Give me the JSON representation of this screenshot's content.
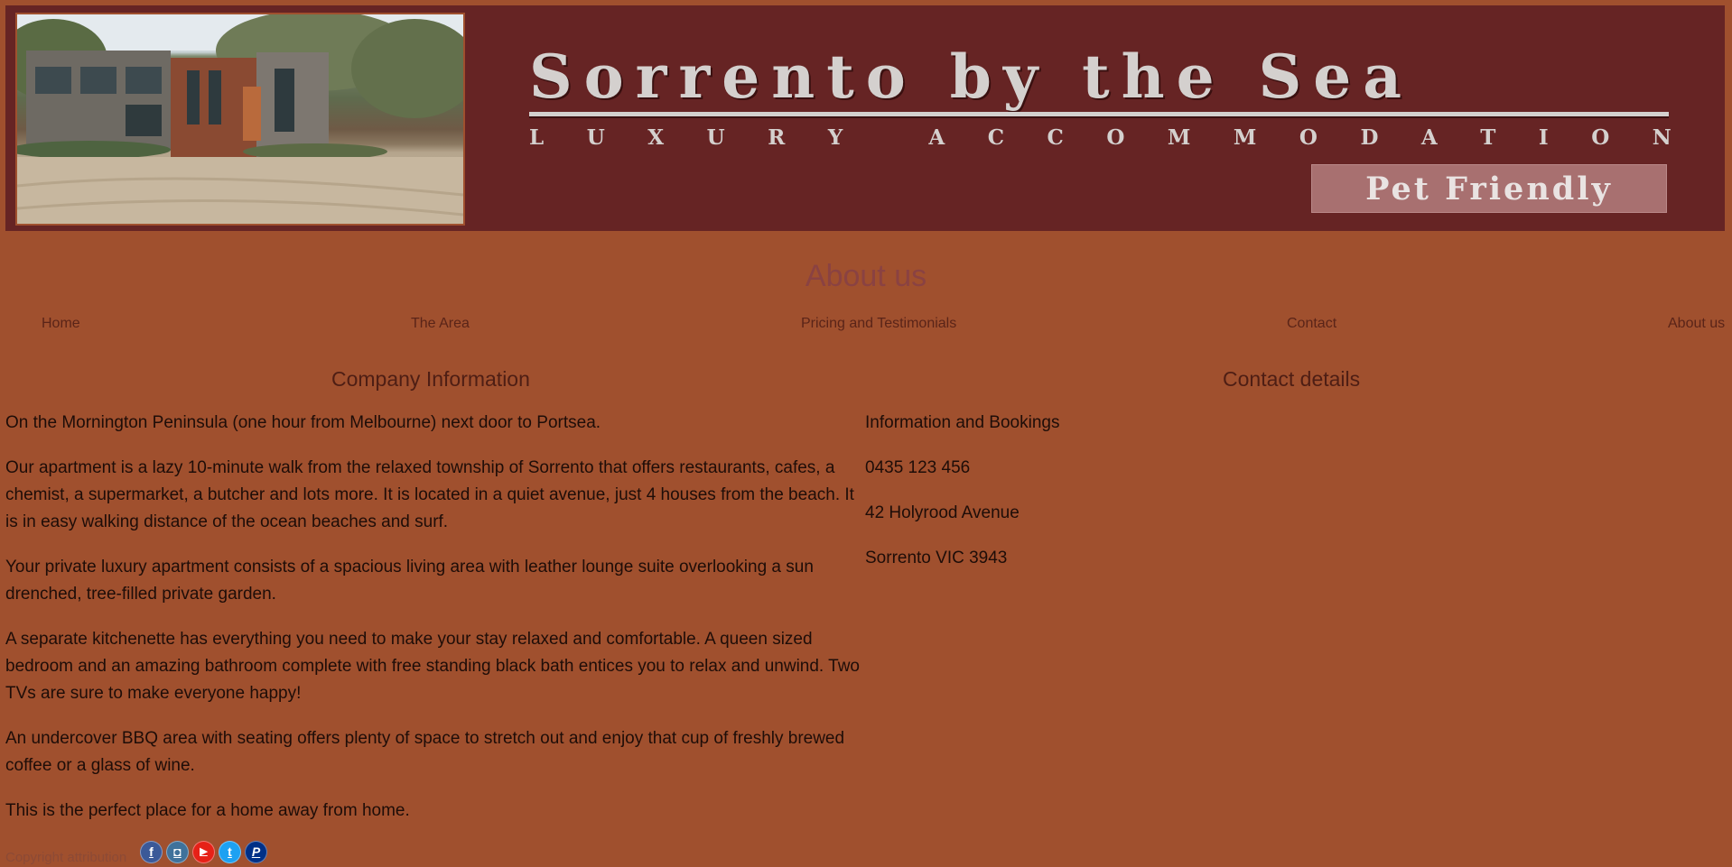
{
  "header": {
    "title": "Sorrento by the Sea",
    "tagline": [
      "L",
      "U",
      "X",
      "U",
      "R",
      "Y",
      " ",
      "A",
      "C",
      "C",
      "O",
      "M",
      "M",
      "O",
      "D",
      "A",
      "T",
      "I",
      "O",
      "N"
    ],
    "badge": "Pet Friendly"
  },
  "page_title": "About us",
  "nav": {
    "items": [
      {
        "label": "Home"
      },
      {
        "label": "The Area"
      },
      {
        "label": "Pricing and Testimonials"
      },
      {
        "label": "Contact"
      },
      {
        "label": "About us"
      }
    ]
  },
  "company": {
    "heading": "Company Information",
    "paragraphs": [
      "On the Mornington Peninsula (one hour from Melbourne) next door to Portsea.",
      "Our apartment is a lazy 10-minute walk from the relaxed township of Sorrento that offers restaurants, cafes, a chemist, a supermarket, a butcher and lots more. It is located in a quiet avenue, just 4 houses from the beach. It is in easy walking distance of the ocean beaches and surf.",
      "Your private luxury apartment consists of a spacious living area with leather lounge suite overlooking a sun drenched, tree-filled private garden.",
      "A separate kitchenette has everything you need to make your stay relaxed and comfortable. A queen sized bedroom and an amazing bathroom complete with free standing black bath entices you to relax and unwind. Two TVs are sure to make everyone happy!",
      "An undercover BBQ area with seating offers plenty of space to stretch out and enjoy that cup of freshly brewed coffee or a glass of wine.",
      "This is the perfect place for a home away from home."
    ]
  },
  "contact": {
    "heading": "Contact details",
    "lines": [
      "Information and Bookings",
      "0435 123 456",
      "42 Holyrood Avenue",
      "Sorrento VIC 3943"
    ]
  },
  "footer": {
    "copyright": "Copyright attribution",
    "social": [
      {
        "icon": "facebook-icon",
        "glyph": "f",
        "color": "#3b5998"
      },
      {
        "icon": "instagram-icon",
        "glyph": "◘",
        "color": "#3f729b"
      },
      {
        "icon": "youtube-icon",
        "glyph": "▶",
        "color": "#e62117"
      },
      {
        "icon": "twitter-icon",
        "glyph": "t",
        "color": "#1da1f2"
      },
      {
        "icon": "paypal-icon",
        "glyph": "P",
        "color": "#003087"
      }
    ]
  },
  "colors": {
    "page_background": "#a0502e",
    "header_background": "#662424",
    "title_color": "#8a4242"
  }
}
